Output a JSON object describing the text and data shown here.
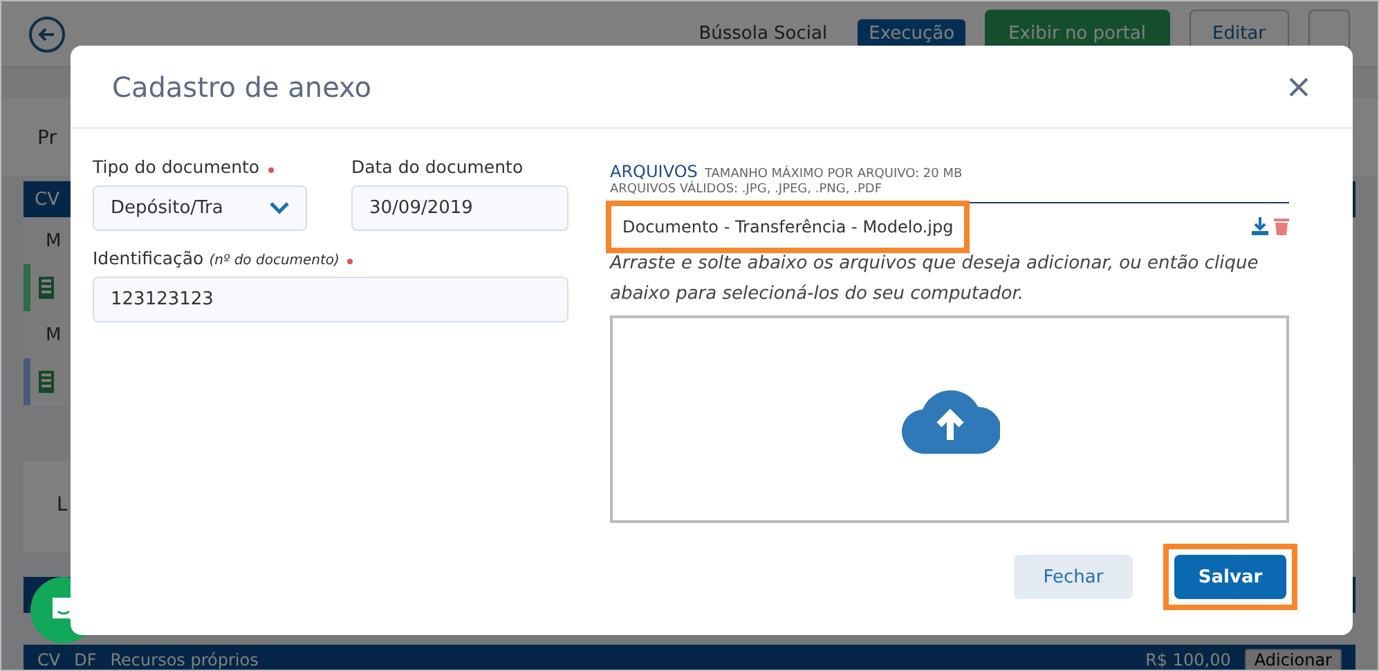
{
  "page": {
    "tags": [
      "Bússola Social",
      "Execução"
    ],
    "buttons": [
      "Exibir no portal",
      "Editar"
    ],
    "tab": "Pr",
    "rows": [
      {
        "kind": "header",
        "text": "CV"
      },
      {
        "kind": "item",
        "text": "M"
      },
      {
        "kind": "doc",
        "color": "#2f6b45"
      },
      {
        "kind": "item",
        "text": "M"
      },
      {
        "kind": "doc",
        "color": "#4a5a78"
      }
    ],
    "section": "L",
    "footer": {
      "codes": [
        "CV",
        "DF"
      ],
      "label": "Recursos próprios",
      "amount": "R$ 100,00",
      "action": "Adicionar"
    }
  },
  "dialog": {
    "title": "Cadastro de anexo",
    "fields": [
      {
        "label": "Tipo do documento",
        "required": true,
        "kind": "select",
        "value": "Depósito/Tra"
      },
      {
        "label": "Data do documento",
        "required": false,
        "kind": "text",
        "value": "30/09/2019"
      },
      {
        "label": "Identificação",
        "hint": "(nº do documento)",
        "required": true,
        "kind": "text",
        "value": "123123123"
      }
    ],
    "files": {
      "heading": "ARQUIVOS",
      "max_size": "TAMANHO MÁXIMO POR ARQUIVO: 20 MB",
      "valid": "ARQUIVOS VÁLIDOS: .JPG, .JPEG, .PNG, .PDF",
      "items": [
        {
          "name": "Documento - Transferência - Modelo.jpg",
          "highlighted": true
        }
      ],
      "instructions": "Arraste e solte abaixo os arquivos que deseja adicionar, ou então clique abaixo para selecioná-los do seu computador."
    },
    "buttons": [
      {
        "label": "Fechar",
        "kind": "secondary",
        "highlighted": false
      },
      {
        "label": "Salvar",
        "kind": "primary",
        "highlighted": true
      }
    ]
  }
}
